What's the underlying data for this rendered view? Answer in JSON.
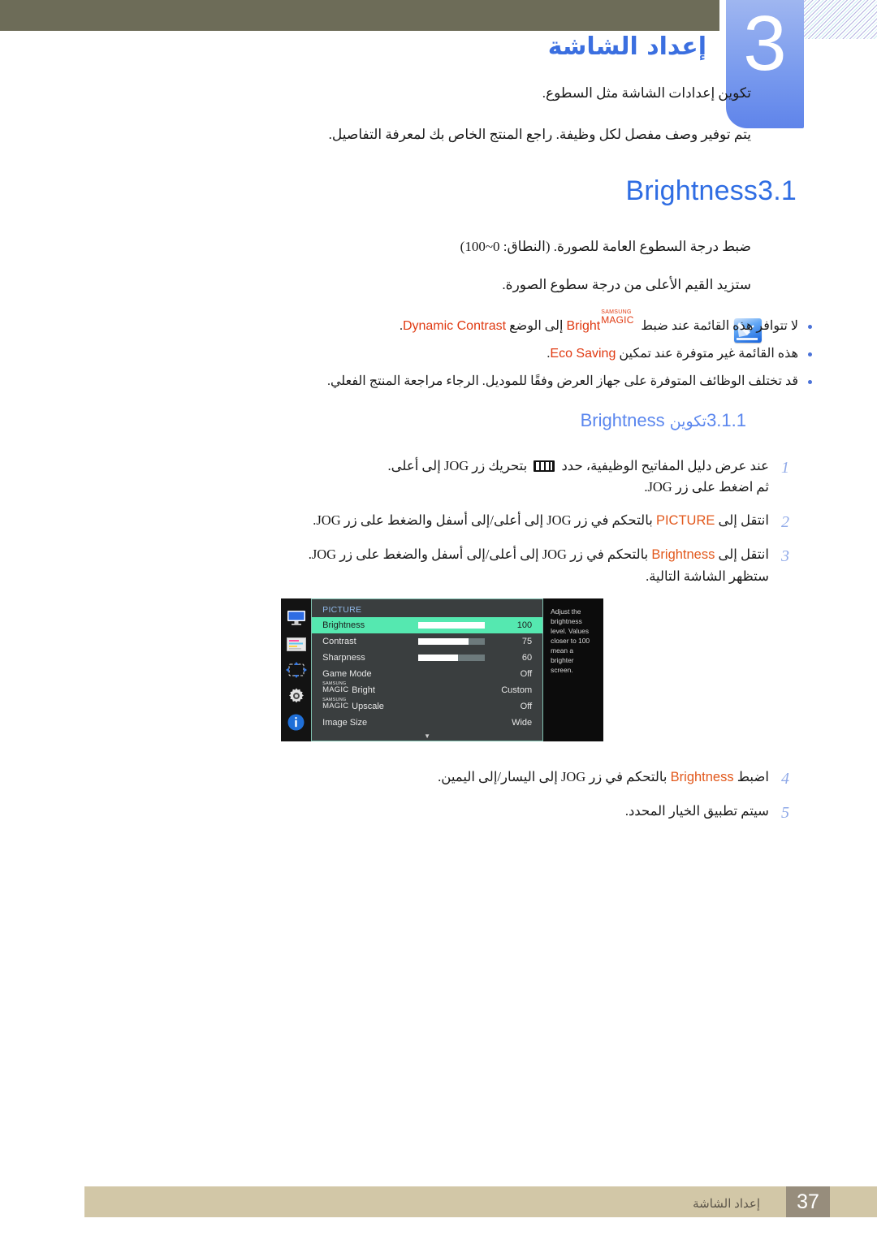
{
  "header": {
    "chapter_number": "3",
    "chapter_title": "إعداد الشاشة",
    "intro_line_1": "تكوين إعدادات الشاشة مثل السطوع.",
    "intro_line_2": "يتم توفير وصف مفصل لكل وظيفة. راجع المنتج الخاص بك لمعرفة التفاصيل.",
    "band_color": "#6d6c58",
    "tab_color": "#7a9bee"
  },
  "section": {
    "number": "3.1",
    "title": "Brightness",
    "heading_color": "#2f6de3",
    "paragraph_range": "ضبط درجة السطوع العامة للصورة. (النطاق: 0~100)",
    "paragraph_values": "ستزيد القيم الأعلى من درجة سطوع الصورة."
  },
  "notes": {
    "icon_name": "note-pencil-icon",
    "items": [
      {
        "prefix": "لا تتوافر هذه القائمة عند ضبط ",
        "magic_top": "SAMSUNG",
        "magic_bottom": "MAGIC",
        "magic_suffix": "Bright",
        "middle": " إلى الوضع ",
        "keyword": "Dynamic Contrast",
        "suffix": "."
      },
      {
        "prefix": "هذه القائمة غير متوفرة عند تمكين ",
        "keyword": "Eco Saving",
        "suffix": "."
      },
      {
        "plain": "قد تختلف الوظائف المتوفرة على جهاز العرض وفقًا للموديل. الرجاء مراجعة المنتج الفعلي."
      }
    ]
  },
  "subsection": {
    "number": "3.1.1",
    "label_ar": "تكوين",
    "label_en": "Brightness",
    "heading_color": "#5a86ee"
  },
  "steps": [
    {
      "number": "1",
      "text_a": "عند عرض دليل المفاتيح الوظيفية، حدد ",
      "icon": "jog-guide-icon",
      "text_b": " بتحريك زر JOG إلى أعلى.",
      "line2": "ثم اضغط على زر JOG."
    },
    {
      "number": "2",
      "text_a": "انتقل إلى ",
      "keyword": "PICTURE",
      "text_b": " بالتحكم في زر JOG إلى أعلى/إلى أسفل والضغط على زر JOG."
    },
    {
      "number": "3",
      "text_a": "انتقل إلى ",
      "keyword": "Brightness",
      "text_b": " بالتحكم في زر JOG إلى أعلى/إلى أسفل والضغط على زر JOG.",
      "line2": "ستظهر الشاشة التالية."
    },
    {
      "number": "4",
      "text_a": "اضبط ",
      "keyword": "Brightness",
      "text_b": " بالتحكم في زر JOG إلى اليسار/إلى اليمين."
    },
    {
      "number": "5",
      "text_a": "سيتم تطبيق الخيار المحدد."
    }
  ],
  "osd": {
    "menu_title": "PICTURE",
    "rail_icons": [
      "monitor-icon",
      "color-panel-icon",
      "resize-arrows-icon",
      "gear-icon",
      "info-icon"
    ],
    "rows": [
      {
        "label": "Brightness",
        "value": "100",
        "bar": 100,
        "selected": true,
        "has_bar": true
      },
      {
        "label": "Contrast",
        "value": "75",
        "bar": 75,
        "selected": false,
        "has_bar": true
      },
      {
        "label": "Sharpness",
        "value": "60",
        "bar": 60,
        "selected": false,
        "has_bar": true
      },
      {
        "label": "Game Mode",
        "value": "Off",
        "selected": false,
        "has_bar": false
      },
      {
        "label": "Bright",
        "value": "Custom",
        "selected": false,
        "has_bar": false,
        "magic": true,
        "magic_top": "SAMSUNG",
        "magic_bottom": "MAGIC"
      },
      {
        "label": "Upscale",
        "value": "Off",
        "selected": false,
        "has_bar": false,
        "magic": true,
        "magic_top": "SAMSUNG",
        "magic_bottom": "MAGIC"
      },
      {
        "label": "Image Size",
        "value": "Wide",
        "selected": false,
        "has_bar": false
      }
    ],
    "scroll_indicator": "▼",
    "help_text": "Adjust the brightness level. Values closer to 100 mean a brighter screen.",
    "highlight_color": "#55e8b0",
    "panel_color": "#3a3e3f",
    "title_color": "#8fb8e8"
  },
  "footer": {
    "section_name": "إعداد الشاشة",
    "page_number": "37",
    "bar_color": "#d2c7a7",
    "page_box_color": "#978d7c"
  }
}
